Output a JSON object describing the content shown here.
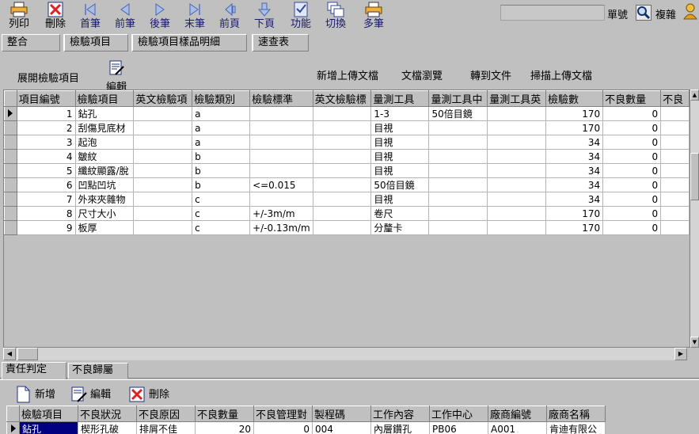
{
  "toolbar": {
    "buttons": [
      {
        "id": "print",
        "label": "列印",
        "icon": "printer-icon",
        "disabled": false
      },
      {
        "id": "delete",
        "label": "刪除",
        "icon": "delete-icon",
        "disabled": false
      },
      {
        "id": "first",
        "label": "首筆",
        "icon": "first-record-icon",
        "disabled": true
      },
      {
        "id": "prev",
        "label": "前筆",
        "icon": "prev-record-icon",
        "disabled": true
      },
      {
        "id": "next",
        "label": "後筆",
        "icon": "next-record-icon",
        "disabled": true
      },
      {
        "id": "last",
        "label": "末筆",
        "icon": "last-record-icon",
        "disabled": true
      },
      {
        "id": "prev_page",
        "label": "前頁",
        "icon": "prev-page-icon",
        "disabled": true
      },
      {
        "id": "next_page",
        "label": "下頁",
        "icon": "next-page-icon",
        "disabled": true
      },
      {
        "id": "function",
        "label": "功能",
        "icon": "checklist-icon",
        "disabled": true
      },
      {
        "id": "switch",
        "label": "切換",
        "icon": "windows-icon",
        "disabled": true
      },
      {
        "id": "multi",
        "label": "多筆",
        "icon": "printer-icon",
        "disabled": true
      }
    ],
    "doc_number_label": "單號",
    "doc_number_value": "",
    "copy_label": "複雜"
  },
  "top_tabs": [
    "整合",
    "檢驗項目",
    "檢驗項目樣品明細",
    "速查表"
  ],
  "sub_toolbar": {
    "expand_label": "展開檢驗項目",
    "edit_label": "編輯",
    "links": [
      "新增上傳文檔",
      "文檔瀏覽",
      "轉到文件",
      "掃描上傳文檔"
    ]
  },
  "main_grid": {
    "columns": [
      "項目編號",
      "檢驗項目",
      "英文檢驗項",
      "檢驗類別",
      "檢驗標準",
      "英文檢驗標",
      "量測工具",
      "量測工具中",
      "量測工具英",
      "檢驗數",
      "不良數量",
      "不良"
    ],
    "rows": [
      [
        "1",
        "鉆孔",
        "",
        "a",
        "",
        "",
        "1-3",
        "50倍目鏡",
        "",
        "170",
        "0",
        ""
      ],
      [
        "2",
        "刮傷見底材",
        "",
        "a",
        "",
        "",
        "目視",
        "",
        "",
        "170",
        "0",
        ""
      ],
      [
        "3",
        "起泡",
        "",
        "a",
        "",
        "",
        "目視",
        "",
        "",
        "34",
        "0",
        ""
      ],
      [
        "4",
        "皺紋",
        "",
        "b",
        "",
        "",
        "目視",
        "",
        "",
        "34",
        "0",
        ""
      ],
      [
        "5",
        "纖紋顯露/脫",
        "",
        "b",
        "",
        "",
        "目視",
        "",
        "",
        "34",
        "0",
        ""
      ],
      [
        "6",
        "凹點凹坑",
        "",
        "b",
        "<=0.015",
        "",
        "50倍目鏡",
        "",
        "",
        "34",
        "0",
        ""
      ],
      [
        "7",
        "外來夾雜物",
        "",
        "c",
        "",
        "",
        "目視",
        "",
        "",
        "34",
        "0",
        ""
      ],
      [
        "8",
        "尺寸大小",
        "",
        "c",
        "+/-3m/m",
        "",
        "卷尺",
        "",
        "",
        "170",
        "0",
        ""
      ],
      [
        "9",
        "板厚",
        "",
        "c",
        "+/-0.13m/m",
        "",
        "分釐卡",
        "",
        "",
        "170",
        "0",
        ""
      ]
    ]
  },
  "bottom_tabs": [
    "責任判定",
    "不良歸屬"
  ],
  "bottom_actions": [
    {
      "id": "add",
      "label": "新增",
      "icon": "new-document-icon"
    },
    {
      "id": "edit",
      "label": "編輯",
      "icon": "edit-document-icon"
    },
    {
      "id": "delete",
      "label": "刪除",
      "icon": "delete-icon"
    }
  ],
  "detail_grid": {
    "columns": [
      "檢驗項目",
      "不良狀況",
      "不良原因",
      "不良數量",
      "不良管理對",
      "製程碼",
      "工作內容",
      "工作中心",
      "廠商編號",
      "廠商名稱"
    ],
    "rows": [
      [
        "鉆孔",
        "楔形孔破",
        "排屑不佳",
        "20",
        "0",
        "004",
        "內層鑽孔",
        "PB06",
        "A001",
        "肯迪有限公"
      ]
    ]
  }
}
